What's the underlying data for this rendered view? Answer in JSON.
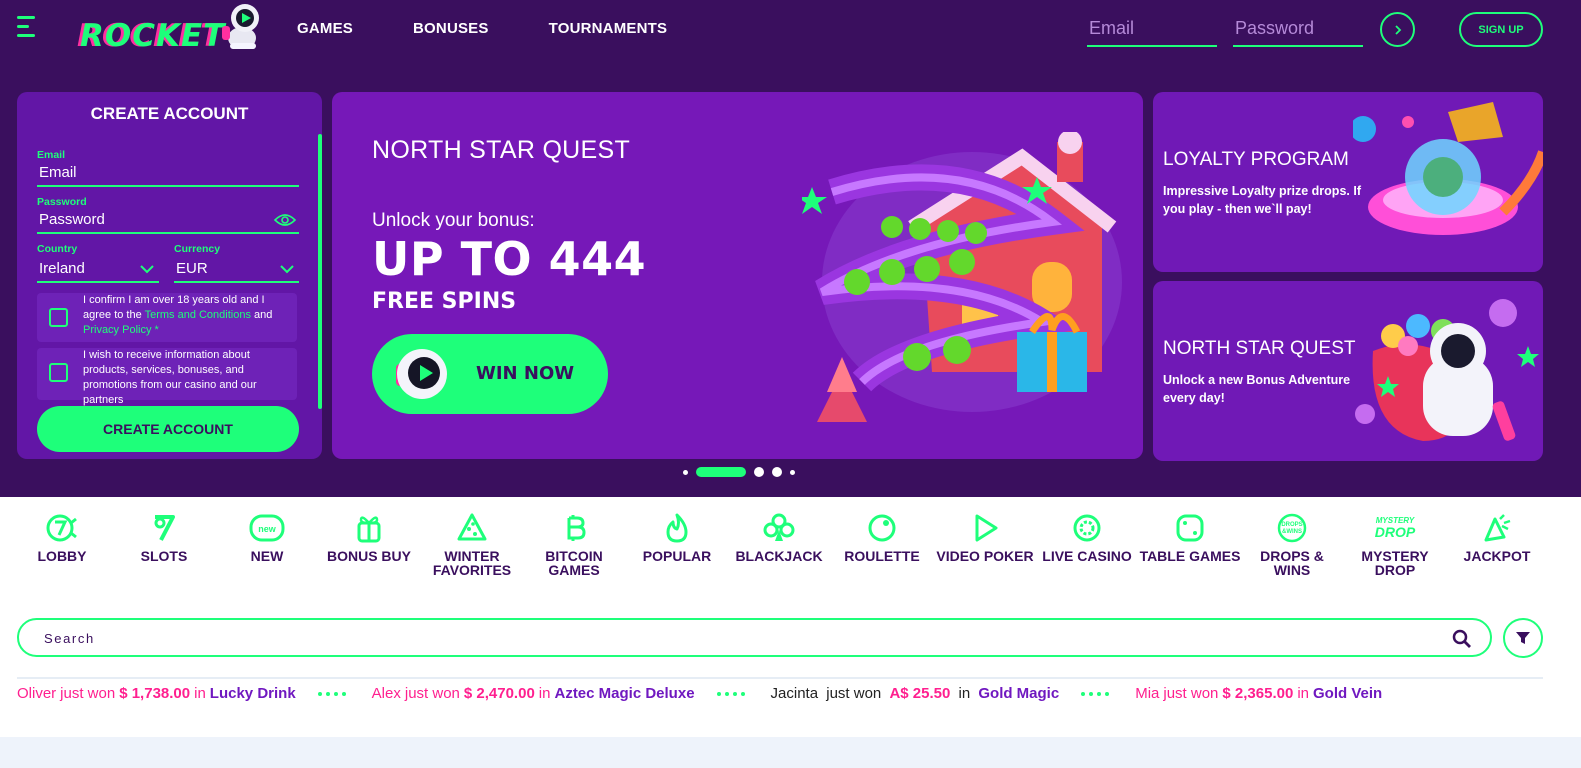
{
  "header": {
    "logo_text": "ROCKET",
    "nav": [
      "GAMES",
      "BONUSES",
      "TOURNAMENTS"
    ],
    "email_placeholder": "Email",
    "password_placeholder": "Password",
    "signup_label": "SIGN UP"
  },
  "signup_form": {
    "title": "CREATE ACCOUNT",
    "email_label": "Email",
    "email_value": "Email",
    "password_label": "Password",
    "password_value": "Password",
    "country_label": "Country",
    "country_value": "Ireland",
    "currency_label": "Currency",
    "currency_value": "EUR",
    "age_text_1": "I confirm I am over 18 years old and I agree to the",
    "age_link_1": "Terms and Conditions",
    "age_text_2": "and",
    "age_link_2": "Privacy Policy *",
    "promo_text": "I wish to receive information about products, services, bonuses, and promotions from our casino and our partners",
    "submit_label": "CREATE ACCOUNT"
  },
  "main_banner": {
    "title": "NORTH STAR QUEST",
    "subtitle": "Unlock your bonus:",
    "headline": "UP TO 444",
    "subheadline": "FREE SPINS",
    "cta_label": "WIN NOW"
  },
  "side_cards": [
    {
      "title": "LOYALTY PROGRAM",
      "text": "Impressive Loyalty prize drops. If you play - then we`ll pay!"
    },
    {
      "title": "NORTH STAR QUEST",
      "text": "Unlock a new Bonus Adventure every day!"
    }
  ],
  "carousel": {
    "slides": 5,
    "active": 1
  },
  "categories": [
    {
      "label": "LOBBY",
      "icon": "lobby-icon"
    },
    {
      "label": "SLOTS",
      "icon": "slots-icon"
    },
    {
      "label": "NEW",
      "icon": "new-icon"
    },
    {
      "label": "BONUS BUY",
      "icon": "gift-icon"
    },
    {
      "label": "WINTER FAVORITES",
      "icon": "christmas-tree-icon"
    },
    {
      "label": "BITCOIN GAMES",
      "icon": "bitcoin-icon"
    },
    {
      "label": "POPULAR",
      "icon": "flame-icon"
    },
    {
      "label": "BLACKJACK",
      "icon": "club-icon"
    },
    {
      "label": "ROULETTE",
      "icon": "roulette-icon"
    },
    {
      "label": "VIDEO POKER",
      "icon": "play-icon"
    },
    {
      "label": "LIVE CASINO",
      "icon": "live-casino-icon"
    },
    {
      "label": "TABLE GAMES",
      "icon": "dice-icon"
    },
    {
      "label": "DROPS & WINS",
      "icon": "drops-wins-icon"
    },
    {
      "label": "MYSTERY DROP",
      "icon": "mystery-drop-icon"
    },
    {
      "label": "JACKPOT",
      "icon": "jackpot-icon"
    }
  ],
  "search": {
    "placeholder": "Search"
  },
  "ticker": [
    {
      "name": "Oliver",
      "verb": "just won",
      "amount": "$ 1,738.00",
      "prep": "in",
      "game": "Lucky Drink"
    },
    {
      "name": "Alex",
      "verb": "just won",
      "amount": "$ 2,470.00",
      "prep": "in",
      "game": "Aztec Magic Deluxe"
    },
    {
      "name": "Jacinta",
      "verb": "just won",
      "amount": "A$ 25.50",
      "prep": "in",
      "game": "Gold Magic"
    },
    {
      "name": "Mia",
      "verb": "just won",
      "amount": "$ 2,365.00",
      "prep": "in",
      "game": "Gold Vein"
    }
  ],
  "colors": {
    "accent": "#1eff7a",
    "brand_purple": "#3a0f5e",
    "banner_purple": "#7618b8",
    "winner_pink": "#ff1f8f"
  }
}
